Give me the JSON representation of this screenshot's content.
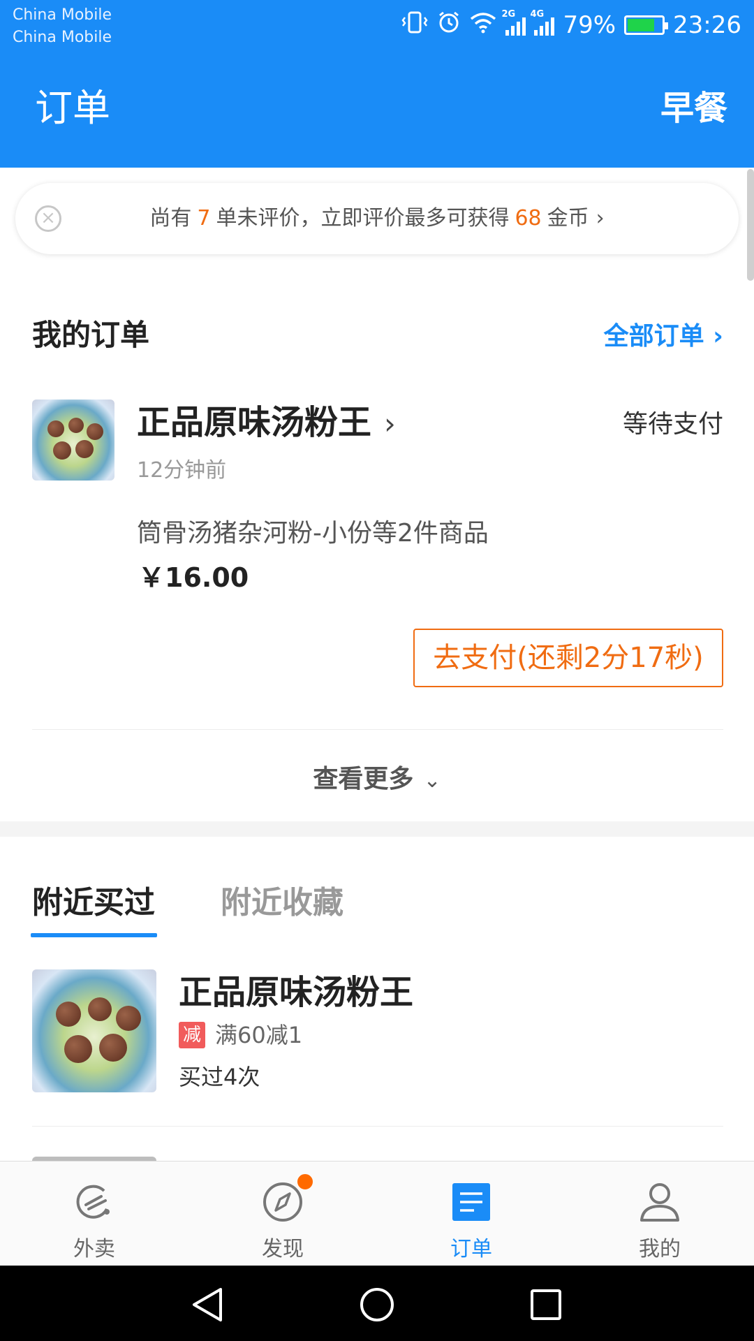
{
  "status_bar": {
    "carrier_1": "China Mobile",
    "carrier_2": "China Mobile",
    "signal_1_label": "2G",
    "signal_2_label": "4G",
    "battery": "79%",
    "battery_level": 0.79,
    "time": "23:26"
  },
  "header": {
    "title": "订单",
    "meal_label": "早餐"
  },
  "review_banner": {
    "prefix": "尚有",
    "count": "7",
    "middle": "单未评价，立即评价最多可获得",
    "coins": "68",
    "suffix": "金币",
    "close_icon": "close-circle-icon",
    "chevron": "›"
  },
  "my_orders": {
    "title": "我的订单",
    "all_orders_label": "全部订单 ›",
    "order": {
      "shop_name": "正品原味汤粉王",
      "shop_chevron": "›",
      "status": "等待支付",
      "time_ago": "12分钟前",
      "items": "筒骨汤猪杂河粉-小份等2件商品",
      "price": "￥16.00",
      "pay_button": "去支付(还剩2分17秒)"
    },
    "see_more": "查看更多",
    "see_more_chevron": "⌄"
  },
  "nearby": {
    "tabs": [
      "附近买过",
      "附近收藏"
    ],
    "active_tab": 0,
    "shop": {
      "name": "正品原味汤粉王",
      "promo_badge": "减",
      "promo_text": "满60减1",
      "bought_count": "买过4次"
    }
  },
  "bottom_nav": {
    "items": [
      {
        "label": "外卖",
        "icon": "takeout-icon"
      },
      {
        "label": "发现",
        "icon": "compass-icon"
      },
      {
        "label": "订单",
        "icon": "order-list-icon"
      },
      {
        "label": "我的",
        "icon": "user-icon"
      }
    ],
    "active_index": 2
  },
  "colors": {
    "brand_blue": "#1a8cf7",
    "accent_orange": "#f06c12",
    "promo_red": "#f15b5b",
    "notification_dot": "#ff6a00"
  }
}
